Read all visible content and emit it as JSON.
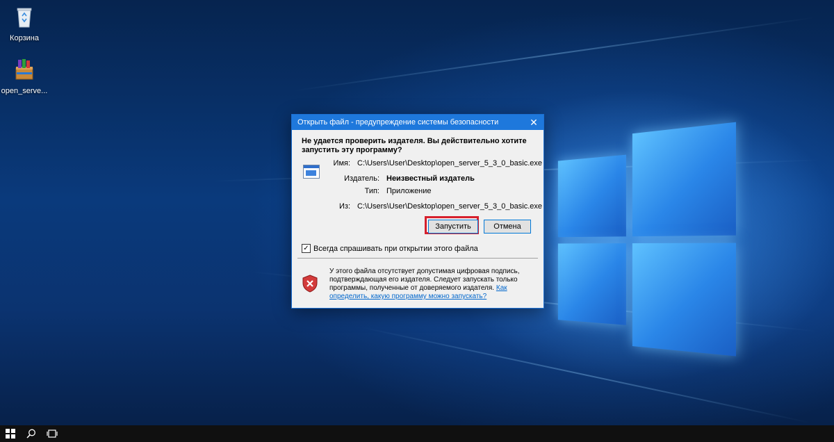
{
  "desktop": {
    "icons": [
      {
        "label": "Корзина",
        "icon": "recycle-bin-icon"
      },
      {
        "label": "open_serve...",
        "icon": "installer-package-icon"
      }
    ]
  },
  "dialog": {
    "title": "Открыть файл - предупреждение системы безопасности",
    "headline": "Не удается проверить издателя.  Вы действительно хотите запустить эту программу?",
    "fields": [
      {
        "label": "Имя:",
        "value": "C:\\Users\\User\\Desktop\\open_server_5_3_0_basic.exe"
      },
      {
        "label": "Издатель:",
        "value": "Неизвестный издатель"
      },
      {
        "label": "Тип:",
        "value": "Приложение"
      },
      {
        "label": "Из:",
        "value": "C:\\Users\\User\\Desktop\\open_server_5_3_0_basic.exe"
      }
    ],
    "run_label": "Запустить",
    "cancel_label": "Отмена",
    "checkbox_label": "Всегда спрашивать при открытии этого файла",
    "checkbox_checked": true,
    "warning_text": "У этого файла отсутствует допустимая цифровая подпись, подтверждающая его издателя.  Следует запускать только программы, полученные от доверяемого издателя.",
    "warning_link": "Как определить, какую программу можно запускать?",
    "highlight_color": "#d6202d"
  },
  "taskbar": {
    "items": [
      "windows-start-icon",
      "search-icon",
      "task-view-icon"
    ]
  }
}
